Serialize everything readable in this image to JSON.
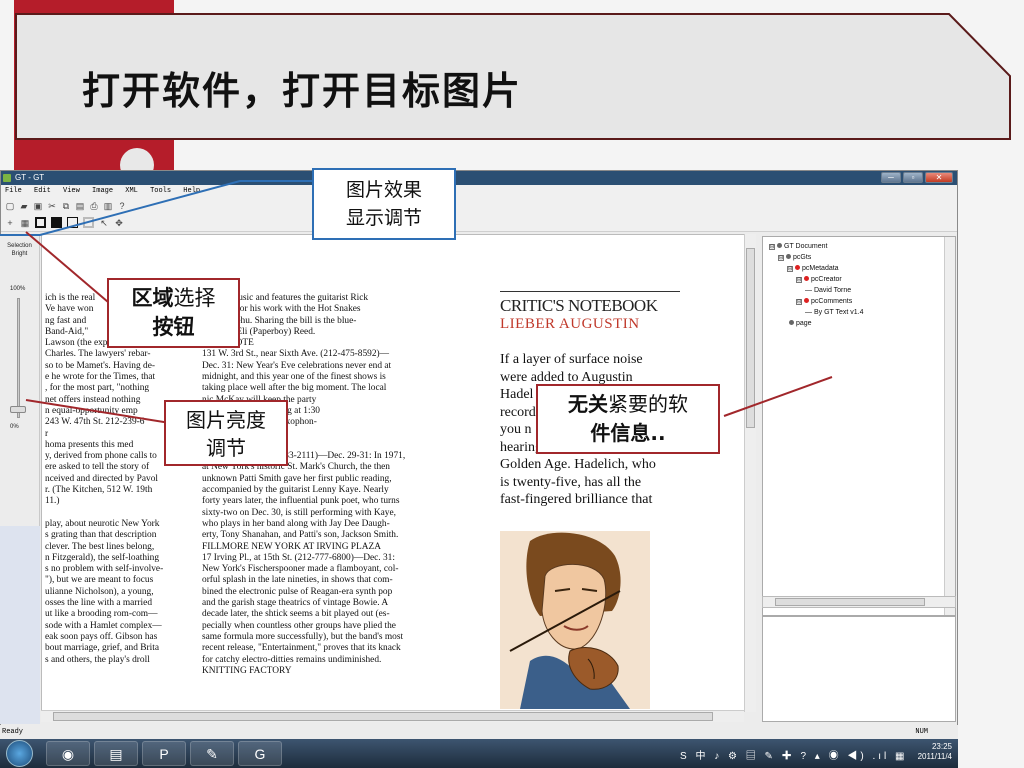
{
  "slide": {
    "title": "打开软件，打开目标图片"
  },
  "window": {
    "title": "GT - GT",
    "controls": [
      "─",
      "▫",
      "✕"
    ],
    "menu": [
      "File",
      "Edit",
      "View",
      "Image",
      "XML",
      "Tools",
      "Help"
    ],
    "status_left": "Ready",
    "status_right": "NUM"
  },
  "left_panel": {
    "label_line1": "Selection",
    "label_line2": "Bright",
    "top_value": "100%",
    "bottom_value": "0%",
    "brightness_level": 0.05
  },
  "document": {
    "col1": "ich is the real\nVe have won\nng fast and\nBand-Aid,\"\nLawson (the expert James\nCharles. The lawyers' rebar-\nso to be Mamet's. Having de-\ne he wrote for the Times, that\n, for the most part, \"nothing\nnet offers instead nothing\nn equal-opportunity emp\n243 W. 47th St. 212-239-6\nr\nhoma presents this med\ny, derived from phone calls to\nere asked to tell the story of\nnceived and directed by Pavol\nr. (The Kitchen, 512 W. 19th\n11.)\n\nplay, about neurotic New York\ns grating than that description\nclever. The best lines belong,\nn Fitzgerald), the self-loathing\ns no problem with self-involve-\n\"), but we are meant to focus\nulianne Nicholson), a young,\nosses the line with a married\nut like a brooding rom-com—\nsode with a Hamlet complex—\neak soon pays off. Gibson has\nbout marriage, grief, and Brita\ns and others, the play's droll",
    "col2": "ingular music and features the guitarist Rick\n, famous for his work with the Hot Snakes\nve Like Jehu. Sharing the bill is the blue-\nal singer Eli (Paperboy) Reed.\nBLUE NOTE\n131 W. 3rd St., near Sixth Ave. (212-475-8592)—\nDec. 31: New Year's Eve celebrations never end at\nmidnight, and this year one of the finest shows is\ntaking place well after the big moment. The local\nnic McKay will keep the party\nelegant fashion, starting at 1:30\nby her husband, the saxophon-\nJacques Schwarz-Bart.\nOOM\n6 Delancey St. (212-533-2111)—Dec. 29-31: In 1971,\nat New York's historic St. Mark's Church, the then\nunknown Patti Smith gave her first public reading,\naccompanied by the guitarist Lenny Kaye. Nearly\nforty years later, the influential punk poet, who turns\nsixty-two on Dec. 30, is still performing with Kaye,\nwho plays in her band along with Jay Dee Daugh-\nerty, Tony Shanahan, and Patti's son, Jackson Smith.\nFILLMORE NEW YORK AT IRVING PLAZA\n17 Irving Pl., at 15th St. (212-777-6800)—Dec. 31:\nNew York's Fischerspooner made a flamboyant, col-\norful splash in the late nineties, in shows that com-\nbined the electronic pulse of Reagan-era synth pop\nand the garish stage theatrics of vintage Bowie. A\ndecade later, the shtick seems a bit played out (es-\npecially when countless other groups have plied the\nsame formula more successfully), but the band's most\nrecent release, \"Entertainment,\" proves that its knack\nfor catchy electro-ditties remains undiminished.\nKNITTING FACTORY",
    "heading1": "CRITIC'S NOTEBOOK",
    "heading2": "LIEBER AUGUSTIN",
    "col3": "If a layer of surface noise\nwere added to Augustin\nHadel\nrecord\nyou n\nhearing a virtuoso out of the\nGolden Age. Hadelich, who\nis twenty-five, has all the\nfast-fingered brilliance that"
  },
  "tree": [
    {
      "label": "GT Document",
      "level": 0,
      "dot": "gray",
      "toggle": "⊟"
    },
    {
      "label": "pcGts",
      "level": 1,
      "dot": "gray",
      "toggle": "⊟"
    },
    {
      "label": "pcMetadata",
      "level": 2,
      "dot": "red",
      "toggle": "⊟"
    },
    {
      "label": "pcCreator",
      "level": 3,
      "dot": "red",
      "toggle": "⊟"
    },
    {
      "label": "David Torne",
      "level": 4,
      "dot": "none",
      "toggle": ""
    },
    {
      "label": "pcComments",
      "level": 3,
      "dot": "red",
      "toggle": "⊟"
    },
    {
      "label": "By GT Text v1.4",
      "level": 4,
      "dot": "none",
      "toggle": ""
    },
    {
      "label": "page",
      "level": 2,
      "dot": "gray",
      "toggle": ""
    }
  ],
  "callouts": {
    "image_effect": "图片效果\n显示调节",
    "region_select_a": "区域",
    "region_select_b": "选择",
    "region_select_c": "按钮",
    "brightness": "图片亮度\n调节",
    "irrelevant_a": "无关",
    "irrelevant_b": "紧要的软",
    "irrelevant_c": "件信息.."
  },
  "taskbar": {
    "time": "23:25",
    "date": "2011/11/4",
    "tray": "S 中 ♪ ⚙ ▤ ✎ ✚ ? ▴ ◉ ◀) .ıl ▦"
  },
  "colors": {
    "accent_red": "#b51d2a",
    "callout_blue": "#2e6fb5",
    "callout_red": "#a1272b"
  }
}
